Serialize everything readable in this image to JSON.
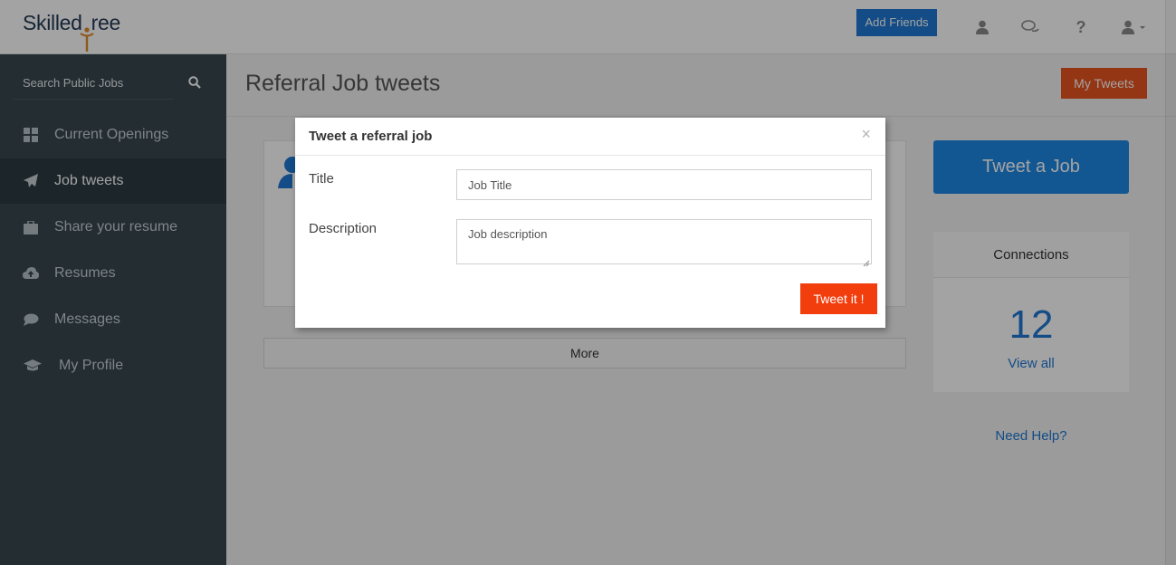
{
  "header": {
    "logo_left": "Skilled",
    "logo_right": "ree",
    "add_friends_label": "Add Friends",
    "icons": [
      "user-icon",
      "chat-icon",
      "help-icon",
      "account-menu-icon"
    ]
  },
  "sidebar": {
    "search_placeholder": "Search Public Jobs",
    "items": [
      {
        "label": "Current Openings",
        "icon": "grid-icon",
        "active": false
      },
      {
        "label": "Job tweets",
        "icon": "paper-plane-icon",
        "active": true
      },
      {
        "label": "Share your resume",
        "icon": "briefcase-icon",
        "active": false
      },
      {
        "label": "Resumes",
        "icon": "cloud-upload-icon",
        "active": false
      },
      {
        "label": "Messages",
        "icon": "chat-bubble-icon",
        "active": false
      },
      {
        "label": "My Profile",
        "icon": "graduation-cap-icon",
        "active": false
      }
    ]
  },
  "main": {
    "page_title": "Referral Job tweets",
    "my_tweets_label": "My Tweets",
    "more_label": "More",
    "tweet_job_label": "Tweet a Job",
    "connections": {
      "title": "Connections",
      "count": "12",
      "link": "View all"
    },
    "need_help": "Need Help?"
  },
  "modal": {
    "title": "Tweet a referral job",
    "close_symbol": "×",
    "title_label": "Title",
    "title_placeholder": "Job Title",
    "description_label": "Description",
    "description_placeholder": "Job description",
    "submit_label": "Tweet it !"
  },
  "colors": {
    "brand_blue": "#1e78d2",
    "sidebar_bg": "#37474f",
    "orange": "#e8531e",
    "tweet_red": "#f23d0d",
    "logo_orange": "#e08a2c"
  }
}
